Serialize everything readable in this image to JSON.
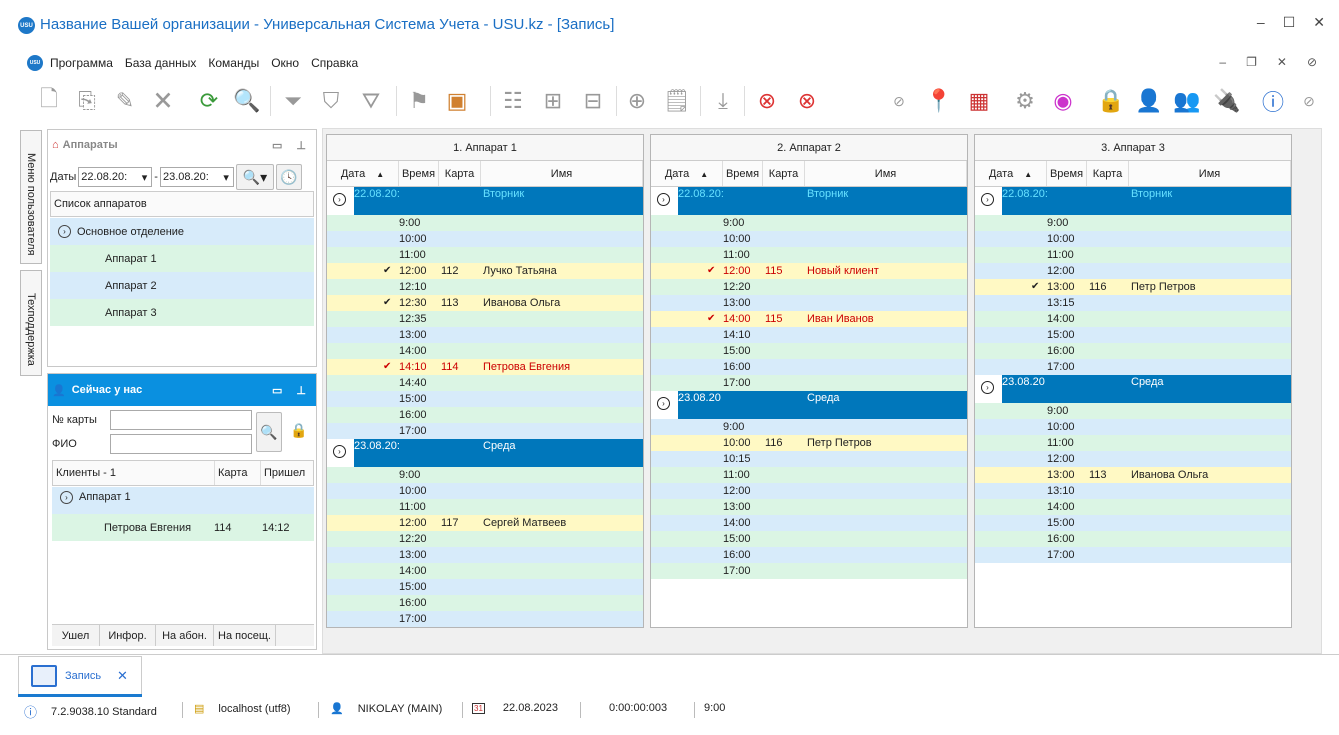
{
  "window": {
    "title": "Название Вашей организации - Универсальная Система Учета - USU.kz - [Запись]",
    "logo": "USU"
  },
  "menu": [
    "Программа",
    "База данных",
    "Команды",
    "Окно",
    "Справка"
  ],
  "sidetabs": [
    "Меню пользователя",
    "Техподдержка"
  ],
  "devices_panel": {
    "title": "Аппараты",
    "dates_label": "Даты",
    "date_from": "22.08.20:",
    "date_to": "23.08.20:",
    "dash": "-",
    "list_header": "Список аппаратов",
    "group": "Основное отделение",
    "items": [
      "Аппарат 1",
      "Аппарат 2",
      "Аппарат 3"
    ]
  },
  "now_panel": {
    "title": "Сейчас у нас",
    "card_label": "№ карты",
    "fio_label": "ФИО",
    "cols": [
      "Клиенты - 1",
      "Карта",
      "Пришел"
    ],
    "group": "Аппарат 1",
    "row": {
      "name": "Петрова Евгения",
      "card": "114",
      "time": "14:12"
    },
    "buttons": [
      "Ушел",
      "Инфор.",
      "На абон.",
      "На посещ."
    ]
  },
  "grid_cols": [
    "Дата",
    "Время",
    "Карта",
    "Имя"
  ],
  "grids": [
    {
      "title": "1. Аппарат 1",
      "days": [
        {
          "date": "22.08.20:",
          "day": "Вторник",
          "cyan": true,
          "rows": [
            {
              "t": "9:00"
            },
            {
              "t": "10:00"
            },
            {
              "t": "11:00"
            },
            {
              "t": "12:00",
              "check": true,
              "card": "112",
              "name": "Лучко Татьяна",
              "hl": true
            },
            {
              "t": "12:10"
            },
            {
              "t": "12:30",
              "check": true,
              "card": "113",
              "name": "Иванова Ольга",
              "hl": true
            },
            {
              "t": "12:35"
            },
            {
              "t": "13:00"
            },
            {
              "t": "14:00"
            },
            {
              "t": "14:10",
              "check": true,
              "card": "114",
              "name": "Петрова Евгения",
              "hl": true,
              "red": true
            },
            {
              "t": "14:40"
            },
            {
              "t": "15:00"
            },
            {
              "t": "16:00"
            },
            {
              "t": "17:00"
            }
          ]
        },
        {
          "date": "23.08.20:",
          "day": "Среда",
          "cyan": false,
          "rows": [
            {
              "t": "9:00"
            },
            {
              "t": "10:00"
            },
            {
              "t": "11:00"
            },
            {
              "t": "12:00",
              "card": "117",
              "name": "Сергей Матвеев",
              "hl": true
            },
            {
              "t": "12:20"
            },
            {
              "t": "13:00"
            },
            {
              "t": "14:00"
            },
            {
              "t": "15:00"
            },
            {
              "t": "16:00"
            },
            {
              "t": "17:00"
            }
          ]
        }
      ]
    },
    {
      "title": "2. Аппарат 2",
      "days": [
        {
          "date": "22.08.20:",
          "day": "Вторник",
          "cyan": true,
          "rows": [
            {
              "t": "9:00"
            },
            {
              "t": "10:00"
            },
            {
              "t": "11:00"
            },
            {
              "t": "12:00",
              "check": true,
              "card": "115",
              "name": "Новый клиент",
              "hl": true,
              "red": true
            },
            {
              "t": "12:20"
            },
            {
              "t": "13:00"
            },
            {
              "t": "14:00",
              "check": true,
              "card": "115",
              "name": "Иван Иванов",
              "hl": true,
              "red": true
            },
            {
              "t": "14:10"
            },
            {
              "t": "15:00"
            },
            {
              "t": "16:00"
            },
            {
              "t": "17:00"
            }
          ]
        },
        {
          "date": "23.08.20",
          "day": "Среда",
          "cyan": false,
          "rows": [
            {
              "t": "9:00"
            },
            {
              "t": "10:00",
              "card": "116",
              "name": "Петр Петров",
              "hl": true
            },
            {
              "t": "10:15"
            },
            {
              "t": "11:00"
            },
            {
              "t": "12:00"
            },
            {
              "t": "13:00"
            },
            {
              "t": "14:00"
            },
            {
              "t": "15:00"
            },
            {
              "t": "16:00"
            },
            {
              "t": "17:00"
            }
          ]
        }
      ]
    },
    {
      "title": "3. Аппарат 3",
      "days": [
        {
          "date": "22.08.20:",
          "day": "Вторник",
          "cyan": true,
          "rows": [
            {
              "t": "9:00"
            },
            {
              "t": "10:00"
            },
            {
              "t": "11:00"
            },
            {
              "t": "12:00"
            },
            {
              "t": "13:00",
              "check": true,
              "card": "116",
              "name": "Петр Петров",
              "hl": true
            },
            {
              "t": "13:15"
            },
            {
              "t": "14:00"
            },
            {
              "t": "15:00"
            },
            {
              "t": "16:00"
            },
            {
              "t": "17:00"
            }
          ]
        },
        {
          "date": "23.08.20",
          "day": "Среда",
          "cyan": false,
          "rows": [
            {
              "t": "9:00"
            },
            {
              "t": "10:00"
            },
            {
              "t": "11:00"
            },
            {
              "t": "12:00"
            },
            {
              "t": "13:00",
              "card": "113",
              "name": "Иванова Ольга",
              "hl": true
            },
            {
              "t": "13:10"
            },
            {
              "t": "14:00"
            },
            {
              "t": "15:00"
            },
            {
              "t": "16:00"
            },
            {
              "t": "17:00"
            }
          ]
        }
      ]
    }
  ],
  "doc_tab": {
    "label": "Запись"
  },
  "status": {
    "version": "7.2.9038.10 Standard",
    "db": "localhost (utf8)",
    "user": "NIKOLAY (MAIN)",
    "date": "22.08.2023",
    "timer": "0:00:00:003",
    "time": "9:00",
    "cal": "31"
  }
}
